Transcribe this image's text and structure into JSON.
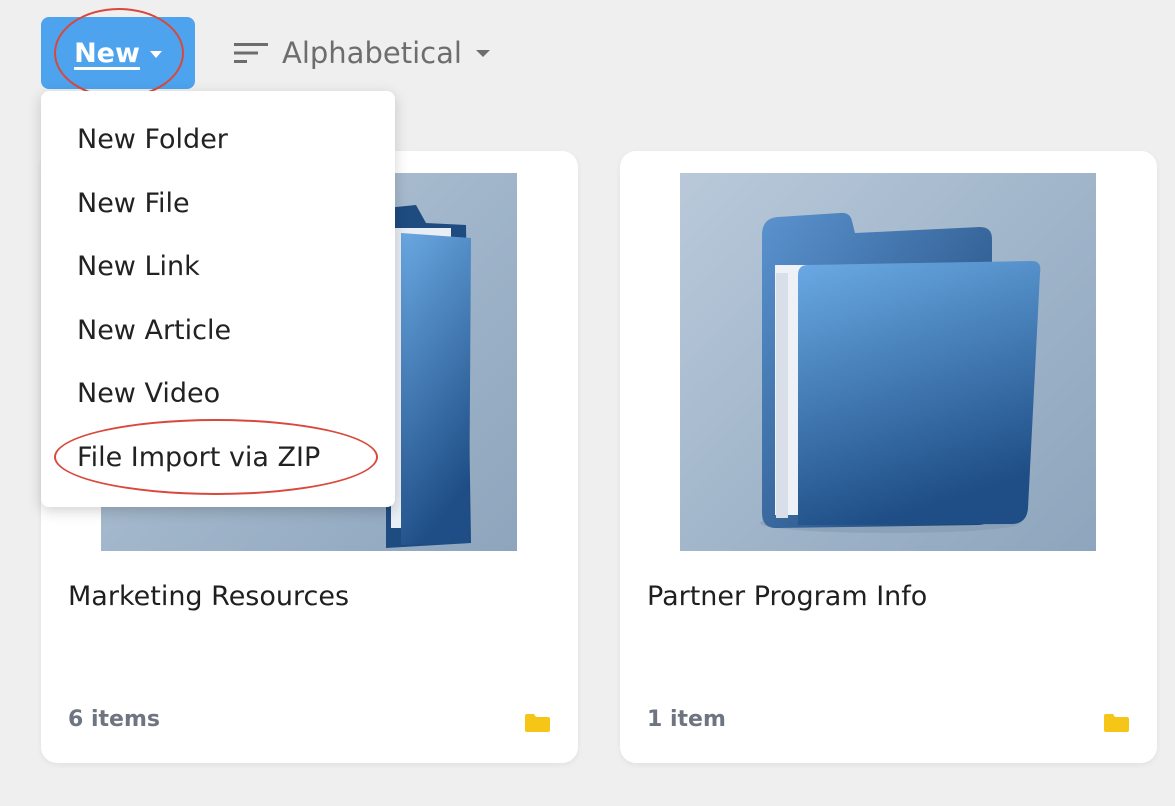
{
  "toolbar": {
    "new_label": "New",
    "sort_label": "Alphabetical",
    "new_button_color": "#4da3ee"
  },
  "menu": {
    "items": [
      {
        "label": "New Folder"
      },
      {
        "label": "New File"
      },
      {
        "label": "New Link"
      },
      {
        "label": "New Article"
      },
      {
        "label": "New Video"
      },
      {
        "label": "File Import via ZIP"
      }
    ]
  },
  "cards": [
    {
      "title": "Marketing Resources",
      "count": "6 items",
      "icon": "folder-icon"
    },
    {
      "title": "Partner Program Info",
      "count": "1 item",
      "icon": "folder-icon"
    }
  ],
  "colors": {
    "accent": "#4da3ee",
    "annotation": "#d9483b",
    "folder_badge": "#f5c518"
  }
}
